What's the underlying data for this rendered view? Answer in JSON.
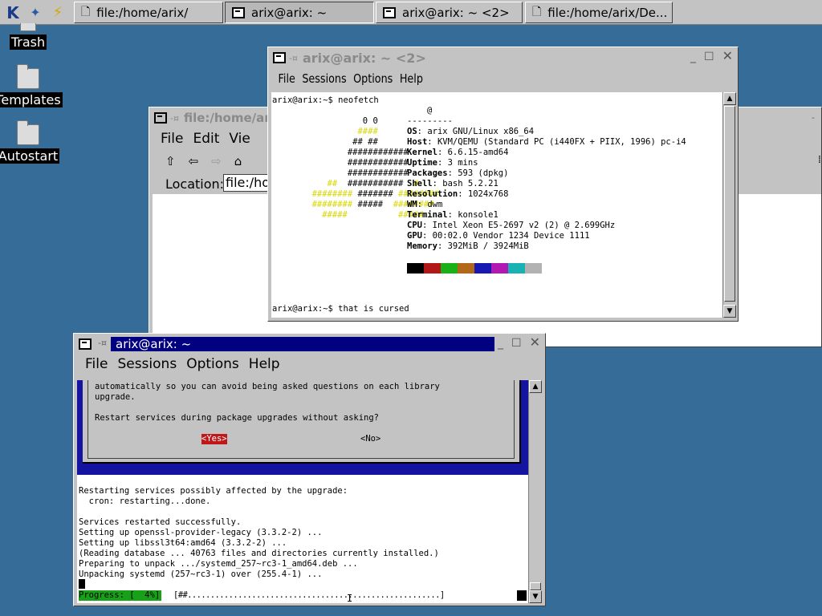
{
  "taskbar": {
    "tasks": [
      {
        "label": "file:/home/arix/",
        "active": false
      },
      {
        "label": "arix@arix: ~",
        "active": true
      },
      {
        "label": "arix@arix: ~ <2>",
        "active": false
      },
      {
        "label": "file:/home/arix/De...",
        "active": false
      }
    ]
  },
  "desktop": {
    "icons": [
      {
        "label": "Trash"
      },
      {
        "label": "Templates"
      },
      {
        "label": "Autostart"
      }
    ]
  },
  "filemanager": {
    "title": "file:/home/ar",
    "menu": {
      "file": "File",
      "edit": "Edit",
      "view": "Vie"
    },
    "location_label": "Location:",
    "location_value": "file:/hon"
  },
  "term2": {
    "title": "arix@arix: ~ <2>",
    "menu": {
      "file": "File",
      "sessions": "Sessions",
      "options": "Options",
      "help": "Help"
    },
    "prompt_line": "arix@arix:~$ neofetch",
    "header_at": "@",
    "header_sep": "---------",
    "info": [
      {
        "key": "OS",
        "value": "arix GNU/Linux x86_64"
      },
      {
        "key": "Host",
        "value": "KVM/QEMU (Standard PC (i440FX + PIIX, 1996) pc-i4"
      },
      {
        "key": "Kernel",
        "value": "6.6.15-amd64"
      },
      {
        "key": "Uptime",
        "value": "3 mins"
      },
      {
        "key": "Packages",
        "value": "593 (dpkg)"
      },
      {
        "key": "Shell",
        "value": "bash 5.2.21"
      },
      {
        "key": "Resolution",
        "value": "1024x768"
      },
      {
        "key": "WM",
        "value": "dwm"
      },
      {
        "key": "Terminal",
        "value": "konsole1"
      },
      {
        "key": "CPU",
        "value": "Intel Xeon E5-2697 v2 (2) @ 2.699GHz"
      },
      {
        "key": "GPU",
        "value": "00:02.0 Vendor 1234 Device 1111"
      },
      {
        "key": "Memory",
        "value": "392MiB / 3924MiB"
      }
    ],
    "palette": [
      "#000000",
      "#b21818",
      "#18b218",
      "#b26818",
      "#1818b2",
      "#b218b2",
      "#18b2b2",
      "#b2b2b2"
    ],
    "last_line": "arix@arix:~$ that is cursed"
  },
  "term1": {
    "title": "arix@arix: ~",
    "menu": {
      "file": "File",
      "sessions": "Sessions",
      "options": "Options",
      "help": "Help"
    },
    "dialog_line1": "automatically so you can avoid being asked questions on each library",
    "dialog_line2": "upgrade.",
    "dialog_question": "Restart services during package upgrades without asking?",
    "yes_label": "<Yes>",
    "no_label": "<No>",
    "output": [
      "Restarting services possibly affected by the upgrade:",
      "  cron: restarting...done.",
      "",
      "Services restarted successfully.",
      "Setting up openssl-provider-legacy (3.3.2-2) ...",
      "Setting up libssl3t64:amd64 (3.3.2-2) ...",
      "(Reading database ... 40763 files and directories currently installed.)",
      "Preparing to unpack .../systemd_257~rc3-1_amd64.deb ...",
      "Unpacking systemd (257~rc3-1) over (255.4-1) ..."
    ],
    "progress_label": "Progress: [  4%]",
    "progress_bar": "[##.......................................................]",
    "progress_fraction": 0.04
  }
}
